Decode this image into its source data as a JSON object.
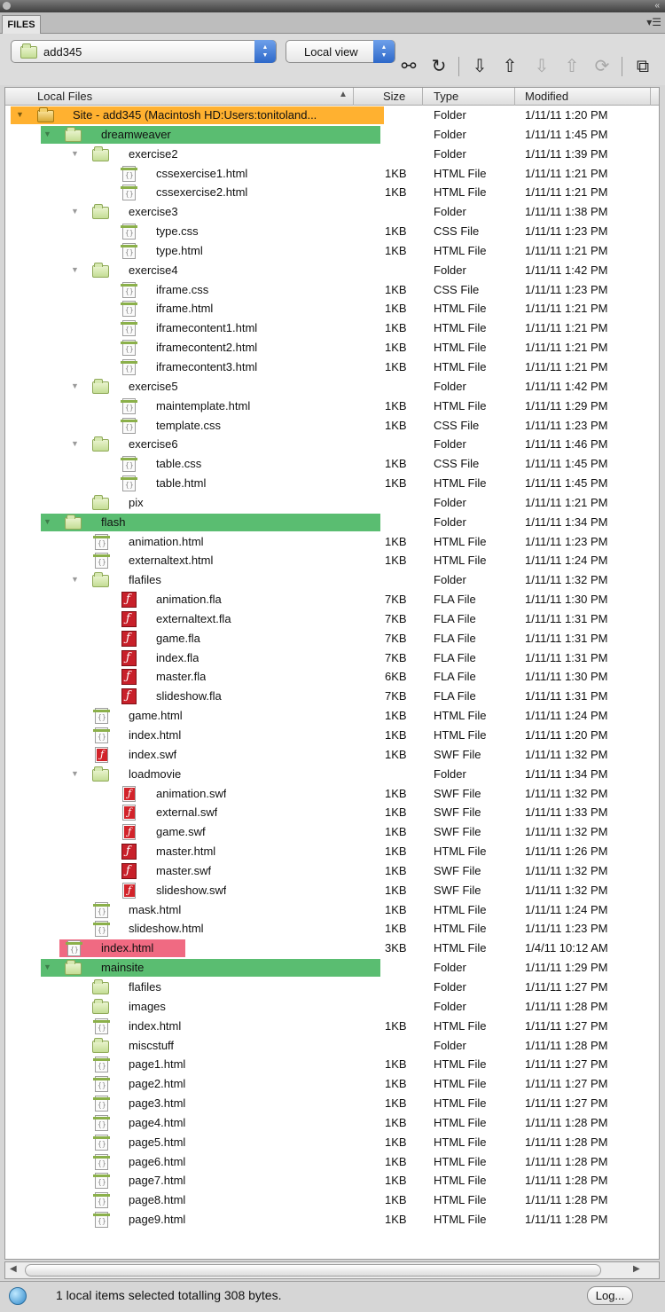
{
  "panel": {
    "tab_label": "FILES",
    "menu_icon": "panel-menu-icon"
  },
  "toolbar": {
    "site_select": {
      "value": "add345"
    },
    "view_select": {
      "value": "Local view"
    },
    "buttons": [
      {
        "name": "connect-icon",
        "glyph": "⚯",
        "disabled": false
      },
      {
        "name": "refresh-icon",
        "glyph": "↻",
        "disabled": false
      },
      {
        "name": "get-files-icon",
        "glyph": "⇩",
        "disabled": false
      },
      {
        "name": "put-files-icon",
        "glyph": "⇧",
        "disabled": false
      },
      {
        "name": "check-out-icon",
        "glyph": "⇩",
        "disabled": true
      },
      {
        "name": "check-in-icon",
        "glyph": "⇧",
        "disabled": true
      },
      {
        "name": "synchronize-icon",
        "glyph": "⟳",
        "disabled": true
      },
      {
        "name": "expand-panel-icon",
        "glyph": "⧉",
        "disabled": false
      }
    ]
  },
  "columns": {
    "local_files": "Local Files",
    "size": "Size",
    "type": "Type",
    "modified": "Modified"
  },
  "files": [
    {
      "name": "Site - add345 (Macintosh HD:Users:tonitoland...",
      "level": 0,
      "kind": "site",
      "expanded": true,
      "size": "",
      "type": "Folder",
      "modified": "1/11/11 1:20 PM",
      "highlight": "orange"
    },
    {
      "name": "dreamweaver",
      "level": 1,
      "kind": "folder",
      "expanded": true,
      "size": "",
      "type": "Folder",
      "modified": "1/11/11 1:45 PM",
      "highlight": "green"
    },
    {
      "name": "exercise2",
      "level": 2,
      "kind": "folder",
      "expanded": true,
      "size": "",
      "type": "Folder",
      "modified": "1/11/11 1:39 PM"
    },
    {
      "name": "cssexercise1.html",
      "level": 3,
      "kind": "doc",
      "size": "1KB",
      "type": "HTML File",
      "modified": "1/11/11 1:21 PM"
    },
    {
      "name": "cssexercise2.html",
      "level": 3,
      "kind": "doc",
      "size": "1KB",
      "type": "HTML File",
      "modified": "1/11/11 1:21 PM"
    },
    {
      "name": "exercise3",
      "level": 2,
      "kind": "folder",
      "expanded": true,
      "size": "",
      "type": "Folder",
      "modified": "1/11/11 1:38 PM"
    },
    {
      "name": "type.css",
      "level": 3,
      "kind": "doc",
      "size": "1KB",
      "type": "CSS File",
      "modified": "1/11/11 1:23 PM"
    },
    {
      "name": "type.html",
      "level": 3,
      "kind": "doc",
      "size": "1KB",
      "type": "HTML File",
      "modified": "1/11/11 1:21 PM"
    },
    {
      "name": "exercise4",
      "level": 2,
      "kind": "folder",
      "expanded": true,
      "size": "",
      "type": "Folder",
      "modified": "1/11/11 1:42 PM"
    },
    {
      "name": "iframe.css",
      "level": 3,
      "kind": "doc",
      "size": "1KB",
      "type": "CSS File",
      "modified": "1/11/11 1:23 PM"
    },
    {
      "name": "iframe.html",
      "level": 3,
      "kind": "doc",
      "size": "1KB",
      "type": "HTML File",
      "modified": "1/11/11 1:21 PM"
    },
    {
      "name": "iframecontent1.html",
      "level": 3,
      "kind": "doc",
      "size": "1KB",
      "type": "HTML File",
      "modified": "1/11/11 1:21 PM"
    },
    {
      "name": "iframecontent2.html",
      "level": 3,
      "kind": "doc",
      "size": "1KB",
      "type": "HTML File",
      "modified": "1/11/11 1:21 PM"
    },
    {
      "name": "iframecontent3.html",
      "level": 3,
      "kind": "doc",
      "size": "1KB",
      "type": "HTML File",
      "modified": "1/11/11 1:21 PM"
    },
    {
      "name": "exercise5",
      "level": 2,
      "kind": "folder",
      "expanded": true,
      "size": "",
      "type": "Folder",
      "modified": "1/11/11 1:42 PM"
    },
    {
      "name": "maintemplate.html",
      "level": 3,
      "kind": "doc",
      "size": "1KB",
      "type": "HTML File",
      "modified": "1/11/11 1:29 PM"
    },
    {
      "name": "template.css",
      "level": 3,
      "kind": "doc",
      "size": "1KB",
      "type": "CSS File",
      "modified": "1/11/11 1:23 PM"
    },
    {
      "name": "exercise6",
      "level": 2,
      "kind": "folder",
      "expanded": true,
      "size": "",
      "type": "Folder",
      "modified": "1/11/11 1:46 PM"
    },
    {
      "name": "table.css",
      "level": 3,
      "kind": "doc",
      "size": "1KB",
      "type": "CSS File",
      "modified": "1/11/11 1:45 PM"
    },
    {
      "name": "table.html",
      "level": 3,
      "kind": "doc",
      "size": "1KB",
      "type": "HTML File",
      "modified": "1/11/11 1:45 PM"
    },
    {
      "name": "pix",
      "level": 2,
      "kind": "folder",
      "size": "",
      "type": "Folder",
      "modified": "1/11/11 1:21 PM"
    },
    {
      "name": "flash",
      "level": 1,
      "kind": "folder",
      "expanded": true,
      "size": "",
      "type": "Folder",
      "modified": "1/11/11 1:34 PM",
      "highlight": "green"
    },
    {
      "name": "animation.html",
      "level": 2,
      "kind": "doc",
      "size": "1KB",
      "type": "HTML File",
      "modified": "1/11/11 1:23 PM"
    },
    {
      "name": "externaltext.html",
      "level": 2,
      "kind": "doc",
      "size": "1KB",
      "type": "HTML File",
      "modified": "1/11/11 1:24 PM"
    },
    {
      "name": "flafiles",
      "level": 2,
      "kind": "folder",
      "expanded": true,
      "size": "",
      "type": "Folder",
      "modified": "1/11/11 1:32 PM"
    },
    {
      "name": "animation.fla",
      "level": 3,
      "kind": "fla",
      "size": "7KB",
      "type": "FLA File",
      "modified": "1/11/11 1:30 PM"
    },
    {
      "name": "externaltext.fla",
      "level": 3,
      "kind": "fla",
      "size": "7KB",
      "type": "FLA File",
      "modified": "1/11/11 1:31 PM"
    },
    {
      "name": "game.fla",
      "level": 3,
      "kind": "fla",
      "size": "7KB",
      "type": "FLA File",
      "modified": "1/11/11 1:31 PM"
    },
    {
      "name": "index.fla",
      "level": 3,
      "kind": "fla",
      "size": "7KB",
      "type": "FLA File",
      "modified": "1/11/11 1:31 PM"
    },
    {
      "name": "master.fla",
      "level": 3,
      "kind": "fla",
      "size": "6KB",
      "type": "FLA File",
      "modified": "1/11/11 1:30 PM"
    },
    {
      "name": "slideshow.fla",
      "level": 3,
      "kind": "fla",
      "size": "7KB",
      "type": "FLA File",
      "modified": "1/11/11 1:31 PM"
    },
    {
      "name": "game.html",
      "level": 2,
      "kind": "doc",
      "size": "1KB",
      "type": "HTML File",
      "modified": "1/11/11 1:24 PM"
    },
    {
      "name": "index.html",
      "level": 2,
      "kind": "doc",
      "size": "1KB",
      "type": "HTML File",
      "modified": "1/11/11 1:20 PM"
    },
    {
      "name": "index.swf",
      "level": 2,
      "kind": "swf",
      "size": "1KB",
      "type": "SWF File",
      "modified": "1/11/11 1:32 PM"
    },
    {
      "name": "loadmovie",
      "level": 2,
      "kind": "folder",
      "expanded": true,
      "size": "",
      "type": "Folder",
      "modified": "1/11/11 1:34 PM"
    },
    {
      "name": "animation.swf",
      "level": 3,
      "kind": "swf",
      "size": "1KB",
      "type": "SWF File",
      "modified": "1/11/11 1:32 PM"
    },
    {
      "name": "external.swf",
      "level": 3,
      "kind": "swf",
      "size": "1KB",
      "type": "SWF File",
      "modified": "1/11/11 1:33 PM"
    },
    {
      "name": "game.swf",
      "level": 3,
      "kind": "swf",
      "size": "1KB",
      "type": "SWF File",
      "modified": "1/11/11 1:32 PM"
    },
    {
      "name": "master.html",
      "level": 3,
      "kind": "fla",
      "size": "1KB",
      "type": "HTML File",
      "modified": "1/11/11 1:26 PM"
    },
    {
      "name": "master.swf",
      "level": 3,
      "kind": "fla",
      "size": "1KB",
      "type": "SWF File",
      "modified": "1/11/11 1:32 PM"
    },
    {
      "name": "slideshow.swf",
      "level": 3,
      "kind": "swf",
      "size": "1KB",
      "type": "SWF File",
      "modified": "1/11/11 1:32 PM"
    },
    {
      "name": "mask.html",
      "level": 2,
      "kind": "doc",
      "size": "1KB",
      "type": "HTML File",
      "modified": "1/11/11 1:24 PM"
    },
    {
      "name": "slideshow.html",
      "level": 2,
      "kind": "doc",
      "size": "1KB",
      "type": "HTML File",
      "modified": "1/11/11 1:23 PM"
    },
    {
      "name": "index.html",
      "level": 1,
      "kind": "doc",
      "size": "3KB",
      "type": "HTML File",
      "modified": "1/4/11 10:12 AM",
      "highlight": "pink"
    },
    {
      "name": "mainsite",
      "level": 1,
      "kind": "folder",
      "expanded": true,
      "size": "",
      "type": "Folder",
      "modified": "1/11/11 1:29 PM",
      "highlight": "green"
    },
    {
      "name": "flafiles",
      "level": 2,
      "kind": "folder",
      "size": "",
      "type": "Folder",
      "modified": "1/11/11 1:27 PM"
    },
    {
      "name": "images",
      "level": 2,
      "kind": "folder",
      "size": "",
      "type": "Folder",
      "modified": "1/11/11 1:28 PM"
    },
    {
      "name": "index.html",
      "level": 2,
      "kind": "doc",
      "size": "1KB",
      "type": "HTML File",
      "modified": "1/11/11 1:27 PM"
    },
    {
      "name": "miscstuff",
      "level": 2,
      "kind": "folder",
      "size": "",
      "type": "Folder",
      "modified": "1/11/11 1:28 PM"
    },
    {
      "name": "page1.html",
      "level": 2,
      "kind": "doc",
      "size": "1KB",
      "type": "HTML File",
      "modified": "1/11/11 1:27 PM"
    },
    {
      "name": "page2.html",
      "level": 2,
      "kind": "doc",
      "size": "1KB",
      "type": "HTML File",
      "modified": "1/11/11 1:27 PM"
    },
    {
      "name": "page3.html",
      "level": 2,
      "kind": "doc",
      "size": "1KB",
      "type": "HTML File",
      "modified": "1/11/11 1:27 PM"
    },
    {
      "name": "page4.html",
      "level": 2,
      "kind": "doc",
      "size": "1KB",
      "type": "HTML File",
      "modified": "1/11/11 1:28 PM"
    },
    {
      "name": "page5.html",
      "level": 2,
      "kind": "doc",
      "size": "1KB",
      "type": "HTML File",
      "modified": "1/11/11 1:28 PM"
    },
    {
      "name": "page6.html",
      "level": 2,
      "kind": "doc",
      "size": "1KB",
      "type": "HTML File",
      "modified": "1/11/11 1:28 PM"
    },
    {
      "name": "page7.html",
      "level": 2,
      "kind": "doc",
      "size": "1KB",
      "type": "HTML File",
      "modified": "1/11/11 1:28 PM"
    },
    {
      "name": "page8.html",
      "level": 2,
      "kind": "doc",
      "size": "1KB",
      "type": "HTML File",
      "modified": "1/11/11 1:28 PM"
    },
    {
      "name": "page9.html",
      "level": 2,
      "kind": "doc",
      "size": "1KB",
      "type": "HTML File",
      "modified": "1/11/11 1:28 PM"
    }
  ],
  "status": {
    "text": "1 local items selected totalling 308 bytes.",
    "log_button": "Log..."
  }
}
